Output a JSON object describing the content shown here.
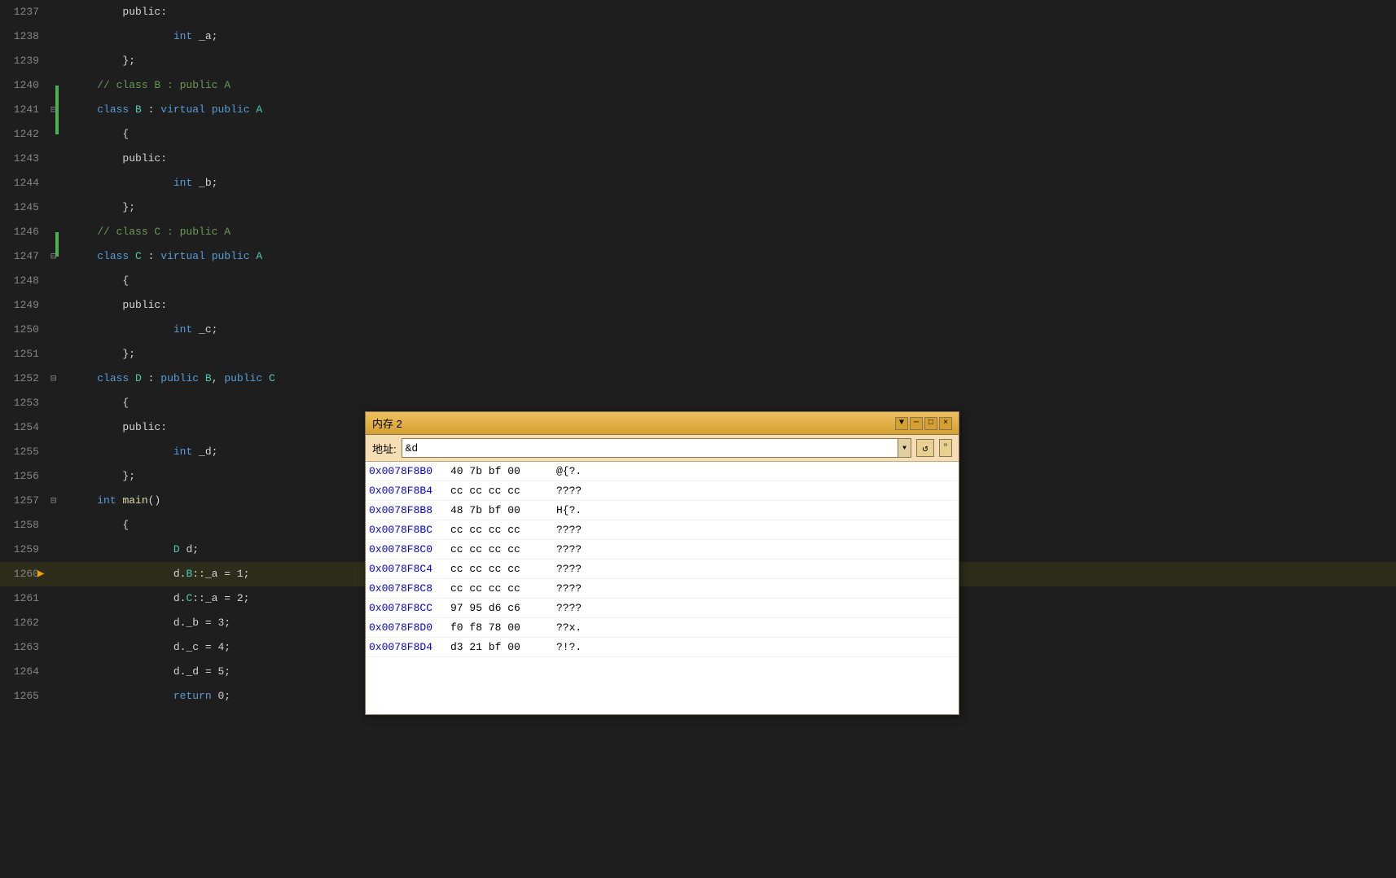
{
  "editor": {
    "background": "#1e1e1e",
    "lines": [
      {
        "num": "1237",
        "indent": 2,
        "gutter": "",
        "code": "public:",
        "tokens": [
          {
            "t": "public:",
            "c": "kw-white"
          }
        ]
      },
      {
        "num": "1238",
        "indent": 3,
        "gutter": "",
        "code": "    int _a;",
        "tokens": [
          {
            "t": "    ",
            "c": ""
          },
          {
            "t": "int",
            "c": "kw-blue"
          },
          {
            "t": " _a;",
            "c": "kw-white"
          }
        ]
      },
      {
        "num": "1239",
        "indent": 2,
        "gutter": "",
        "code": "};",
        "tokens": [
          {
            "t": "};",
            "c": "kw-white"
          }
        ]
      },
      {
        "num": "1240",
        "indent": 1,
        "gutter": "green",
        "code": "// class B : public A",
        "tokens": [
          {
            "t": "// class B : public A",
            "c": "kw-comment"
          }
        ]
      },
      {
        "num": "1241",
        "indent": 1,
        "gutter": "fold-open green",
        "code": "class B : virtual public A",
        "tokens": [
          {
            "t": "class",
            "c": "kw-blue"
          },
          {
            "t": " ",
            "c": ""
          },
          {
            "t": "B",
            "c": "kw-green"
          },
          {
            "t": " : ",
            "c": "kw-white"
          },
          {
            "t": "virtual",
            "c": "kw-blue"
          },
          {
            "t": " ",
            "c": ""
          },
          {
            "t": "public",
            "c": "kw-blue"
          },
          {
            "t": " ",
            "c": ""
          },
          {
            "t": "A",
            "c": "kw-green"
          }
        ]
      },
      {
        "num": "1242",
        "indent": 2,
        "gutter": "",
        "code": "{",
        "tokens": [
          {
            "t": "{",
            "c": "kw-white"
          }
        ]
      },
      {
        "num": "1243",
        "indent": 2,
        "gutter": "",
        "code": "public:",
        "tokens": [
          {
            "t": "public:",
            "c": "kw-white"
          }
        ]
      },
      {
        "num": "1244",
        "indent": 3,
        "gutter": "",
        "code": "    int _b;",
        "tokens": [
          {
            "t": "    ",
            "c": ""
          },
          {
            "t": "int",
            "c": "kw-blue"
          },
          {
            "t": " _b;",
            "c": "kw-white"
          }
        ]
      },
      {
        "num": "1245",
        "indent": 2,
        "gutter": "",
        "code": "};",
        "tokens": [
          {
            "t": "};",
            "c": "kw-white"
          }
        ]
      },
      {
        "num": "1246",
        "indent": 1,
        "gutter": "green",
        "code": "// class C : public A",
        "tokens": [
          {
            "t": "// class C : public A",
            "c": "kw-comment"
          }
        ]
      },
      {
        "num": "1247",
        "indent": 1,
        "gutter": "fold-open",
        "code": "class C : virtual public A",
        "tokens": [
          {
            "t": "class",
            "c": "kw-blue"
          },
          {
            "t": " ",
            "c": ""
          },
          {
            "t": "C",
            "c": "kw-green"
          },
          {
            "t": " : ",
            "c": "kw-white"
          },
          {
            "t": "virtual",
            "c": "kw-blue"
          },
          {
            "t": " ",
            "c": ""
          },
          {
            "t": "public",
            "c": "kw-blue"
          },
          {
            "t": " ",
            "c": ""
          },
          {
            "t": "A",
            "c": "kw-green"
          }
        ]
      },
      {
        "num": "1248",
        "indent": 2,
        "gutter": "",
        "code": "{",
        "tokens": [
          {
            "t": "{",
            "c": "kw-white"
          }
        ]
      },
      {
        "num": "1249",
        "indent": 2,
        "gutter": "",
        "code": "public:",
        "tokens": [
          {
            "t": "public:",
            "c": "kw-white"
          }
        ]
      },
      {
        "num": "1250",
        "indent": 3,
        "gutter": "",
        "code": "    int _c;",
        "tokens": [
          {
            "t": "    ",
            "c": ""
          },
          {
            "t": "int",
            "c": "kw-blue"
          },
          {
            "t": " _c;",
            "c": "kw-white"
          }
        ]
      },
      {
        "num": "1251",
        "indent": 2,
        "gutter": "",
        "code": "};",
        "tokens": [
          {
            "t": "};",
            "c": "kw-white"
          }
        ]
      },
      {
        "num": "1252",
        "indent": 1,
        "gutter": "fold-open",
        "code": "class D : public B,  public C",
        "tokens": [
          {
            "t": "class",
            "c": "kw-blue"
          },
          {
            "t": " ",
            "c": ""
          },
          {
            "t": "D",
            "c": "kw-green"
          },
          {
            "t": " : ",
            "c": "kw-white"
          },
          {
            "t": "public",
            "c": "kw-blue"
          },
          {
            "t": " ",
            "c": ""
          },
          {
            "t": "B",
            "c": "kw-green"
          },
          {
            "t": ", ",
            "c": "kw-white"
          },
          {
            "t": "public",
            "c": "kw-blue"
          },
          {
            "t": " ",
            "c": ""
          },
          {
            "t": "C",
            "c": "kw-green"
          }
        ]
      },
      {
        "num": "1253",
        "indent": 2,
        "gutter": "",
        "code": "{",
        "tokens": [
          {
            "t": "{",
            "c": "kw-white"
          }
        ]
      },
      {
        "num": "1254",
        "indent": 2,
        "gutter": "",
        "code": "public:",
        "tokens": [
          {
            "t": "public:",
            "c": "kw-white"
          }
        ]
      },
      {
        "num": "1255",
        "indent": 3,
        "gutter": "",
        "code": "    int _d;",
        "tokens": [
          {
            "t": "    ",
            "c": ""
          },
          {
            "t": "int",
            "c": "kw-blue"
          },
          {
            "t": " _d;",
            "c": "kw-white"
          }
        ]
      },
      {
        "num": "1256",
        "indent": 2,
        "gutter": "",
        "code": "};",
        "tokens": [
          {
            "t": "};",
            "c": "kw-white"
          }
        ]
      },
      {
        "num": "1257",
        "indent": 1,
        "gutter": "fold-open",
        "code": "int main()",
        "tokens": [
          {
            "t": "int",
            "c": "kw-blue"
          },
          {
            "t": " ",
            "c": ""
          },
          {
            "t": "main",
            "c": "kw-gold"
          },
          {
            "t": "()",
            "c": "kw-white"
          }
        ]
      },
      {
        "num": "1258",
        "indent": 2,
        "gutter": "",
        "code": "{",
        "tokens": [
          {
            "t": "{",
            "c": "kw-white"
          }
        ]
      },
      {
        "num": "1259",
        "indent": 3,
        "gutter": "",
        "code": "    D d;",
        "tokens": [
          {
            "t": "    ",
            "c": ""
          },
          {
            "t": "D",
            "c": "kw-green"
          },
          {
            "t": " d;",
            "c": "kw-white"
          }
        ]
      },
      {
        "num": "1260",
        "indent": 3,
        "gutter": "arrow",
        "code": "    d.B::_a = 1;",
        "tokens": [
          {
            "t": "    d.",
            "c": "kw-white"
          },
          {
            "t": "B",
            "c": "kw-green"
          },
          {
            "t": "::_a = 1;",
            "c": "kw-white"
          }
        ]
      },
      {
        "num": "1261",
        "indent": 3,
        "gutter": "",
        "code": "    d.C::_a = 2;",
        "tokens": [
          {
            "t": "    d.",
            "c": "kw-white"
          },
          {
            "t": "C",
            "c": "kw-green"
          },
          {
            "t": "::_a = 2;",
            "c": "kw-white"
          }
        ]
      },
      {
        "num": "1262",
        "indent": 3,
        "gutter": "",
        "code": "    d._b = 3;",
        "tokens": [
          {
            "t": "    d._b = 3;",
            "c": "kw-white"
          }
        ]
      },
      {
        "num": "1263",
        "indent": 3,
        "gutter": "",
        "code": "    d._c = 4;",
        "tokens": [
          {
            "t": "    d._c = 4;",
            "c": "kw-white"
          }
        ]
      },
      {
        "num": "1264",
        "indent": 3,
        "gutter": "",
        "code": "    d._d = 5;",
        "tokens": [
          {
            "t": "    d._d = 5;",
            "c": "kw-white"
          }
        ]
      },
      {
        "num": "1265",
        "indent": 3,
        "gutter": "",
        "code": "    return 0;",
        "tokens": [
          {
            "t": "    ",
            "c": ""
          },
          {
            "t": "return",
            "c": "kw-blue"
          },
          {
            "t": " 0;",
            "c": "kw-white"
          }
        ]
      }
    ]
  },
  "memory_window": {
    "title": "内存 2",
    "addr_label": "地址:",
    "addr_value": "&d",
    "addr_placeholder": "&d",
    "refresh_icon": "↺",
    "expand_icon": "\"",
    "dropdown_icon": "▼",
    "minimize_icon": "─",
    "maximize_icon": "□",
    "close_icon": "×",
    "rows": [
      {
        "addr": "0x0078F8B0",
        "bytes": "40 7b bf 00",
        "chars": "@{?."
      },
      {
        "addr": "0x0078F8B4",
        "bytes": "cc cc cc cc",
        "chars": "????"
      },
      {
        "addr": "0x0078F8B8",
        "bytes": "48 7b bf 00",
        "chars": "H{?."
      },
      {
        "addr": "0x0078F8BC",
        "bytes": "cc cc cc cc",
        "chars": "????"
      },
      {
        "addr": "0x0078F8C0",
        "bytes": "cc cc cc cc",
        "chars": "????"
      },
      {
        "addr": "0x0078F8C4",
        "bytes": "cc cc cc cc",
        "chars": "????"
      },
      {
        "addr": "0x0078F8C8",
        "bytes": "cc cc cc cc",
        "chars": "????"
      },
      {
        "addr": "0x0078F8CC",
        "bytes": "97 95 d6 c6",
        "chars": "????"
      },
      {
        "addr": "0x0078F8D0",
        "bytes": "f0 f8 78 00",
        "chars": "??x."
      },
      {
        "addr": "0x0078F8D4",
        "bytes": "d3 21 bf 00",
        "chars": "?!?."
      }
    ]
  }
}
